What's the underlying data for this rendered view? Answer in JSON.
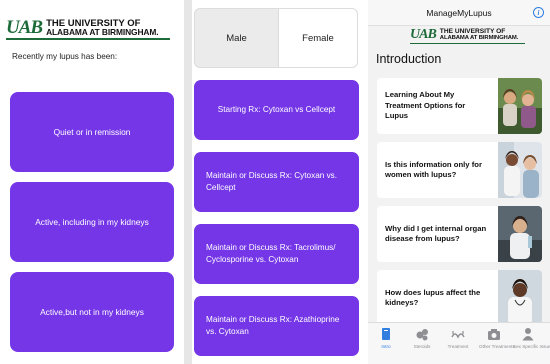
{
  "panel1": {
    "logo": {
      "mark": "UAB",
      "line1": "THE UNIVERSITY OF",
      "line2": "ALABAMA AT BIRMINGHAM."
    },
    "prompt": "Recently my lupus has been:",
    "options": [
      {
        "label": "Quiet or in remission"
      },
      {
        "label": "Active, including in my kidneys"
      },
      {
        "label": "Active,but not in my kidneys"
      }
    ]
  },
  "panel2": {
    "segments": {
      "male": "Male",
      "female": "Female",
      "selected": "Female"
    },
    "rx_options": [
      {
        "label": "Starting Rx: Cytoxan vs Cellcept"
      },
      {
        "label": "Maintain or Discuss Rx: Cytoxan vs. Cellcept"
      },
      {
        "label": "Maintain or Discuss Rx: Tacrolimus/ Cyclosporine vs. Cytoxan"
      },
      {
        "label": "Maintain or Discuss Rx: Azathioprine vs. Cytoxan"
      }
    ]
  },
  "panel3": {
    "nav_title": "ManageMyLupus",
    "info_icon": "info-icon",
    "logo": {
      "mark": "UAB",
      "line1": "THE UNIVERSITY OF",
      "line2": "ALABAMA AT BIRMINGHAM."
    },
    "section_title": "Introduction",
    "cards": [
      {
        "title": "Learning About My Treatment Options for Lupus"
      },
      {
        "title": "Is this information only for women with lupus?"
      },
      {
        "title": "Why did I get internal organ disease from lupus?"
      },
      {
        "title": "How does lupus affect the kidneys?"
      }
    ],
    "tabs": [
      {
        "label": "Intro",
        "icon": "book-icon",
        "active": true
      },
      {
        "label": "Steroids",
        "icon": "pills-icon",
        "active": false
      },
      {
        "label": "Treatment",
        "icon": "treatment-icon",
        "active": false
      },
      {
        "label": "Other Treatments",
        "icon": "camera-icon",
        "active": false
      },
      {
        "label": "Sex Specific Issues",
        "icon": "person-icon",
        "active": false
      }
    ]
  },
  "colors": {
    "accent_purple": "#7436e6",
    "uab_green": "#1e6b3a",
    "ios_blue": "#2f7ee0"
  }
}
